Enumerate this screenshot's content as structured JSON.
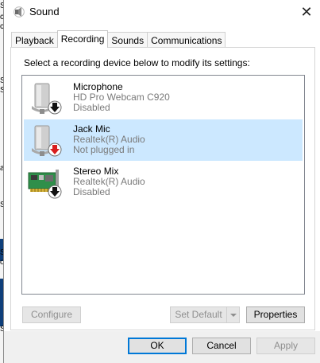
{
  "window": {
    "title": "Sound",
    "close_glyph": "✕"
  },
  "tabs": [
    {
      "label": "Playback",
      "active": false
    },
    {
      "label": "Recording",
      "active": true
    },
    {
      "label": "Sounds",
      "active": false
    },
    {
      "label": "Communications",
      "active": false
    }
  ],
  "instruction": "Select a recording device below to modify its settings:",
  "devices": [
    {
      "name": "Microphone",
      "driver": "HD Pro Webcam C920",
      "status": "Disabled",
      "icon": "microphone-icon",
      "badge": "down-arrow-black",
      "selected": false
    },
    {
      "name": "Jack Mic",
      "driver": "Realtek(R) Audio",
      "status": "Not plugged in",
      "icon": "microphone-icon",
      "badge": "down-arrow-red",
      "selected": true
    },
    {
      "name": "Stereo Mix",
      "driver": "Realtek(R) Audio",
      "status": "Disabled",
      "icon": "sound-card-icon",
      "badge": "down-arrow-black",
      "selected": false
    }
  ],
  "panel_buttons": {
    "configure": "Configure",
    "set_default": "Set Default",
    "properties": "Properties"
  },
  "footer_buttons": {
    "ok": "OK",
    "cancel": "Cancel",
    "apply": "Apply"
  },
  "background_fragments": [
    "S",
    "c",
    "c",
    "S",
    "S",
    "a",
    "S",
    "S",
    "o",
    "S"
  ],
  "colors": {
    "selection": "#cce8ff",
    "accent": "#0078d7",
    "badge_red": "#d81e1e"
  }
}
